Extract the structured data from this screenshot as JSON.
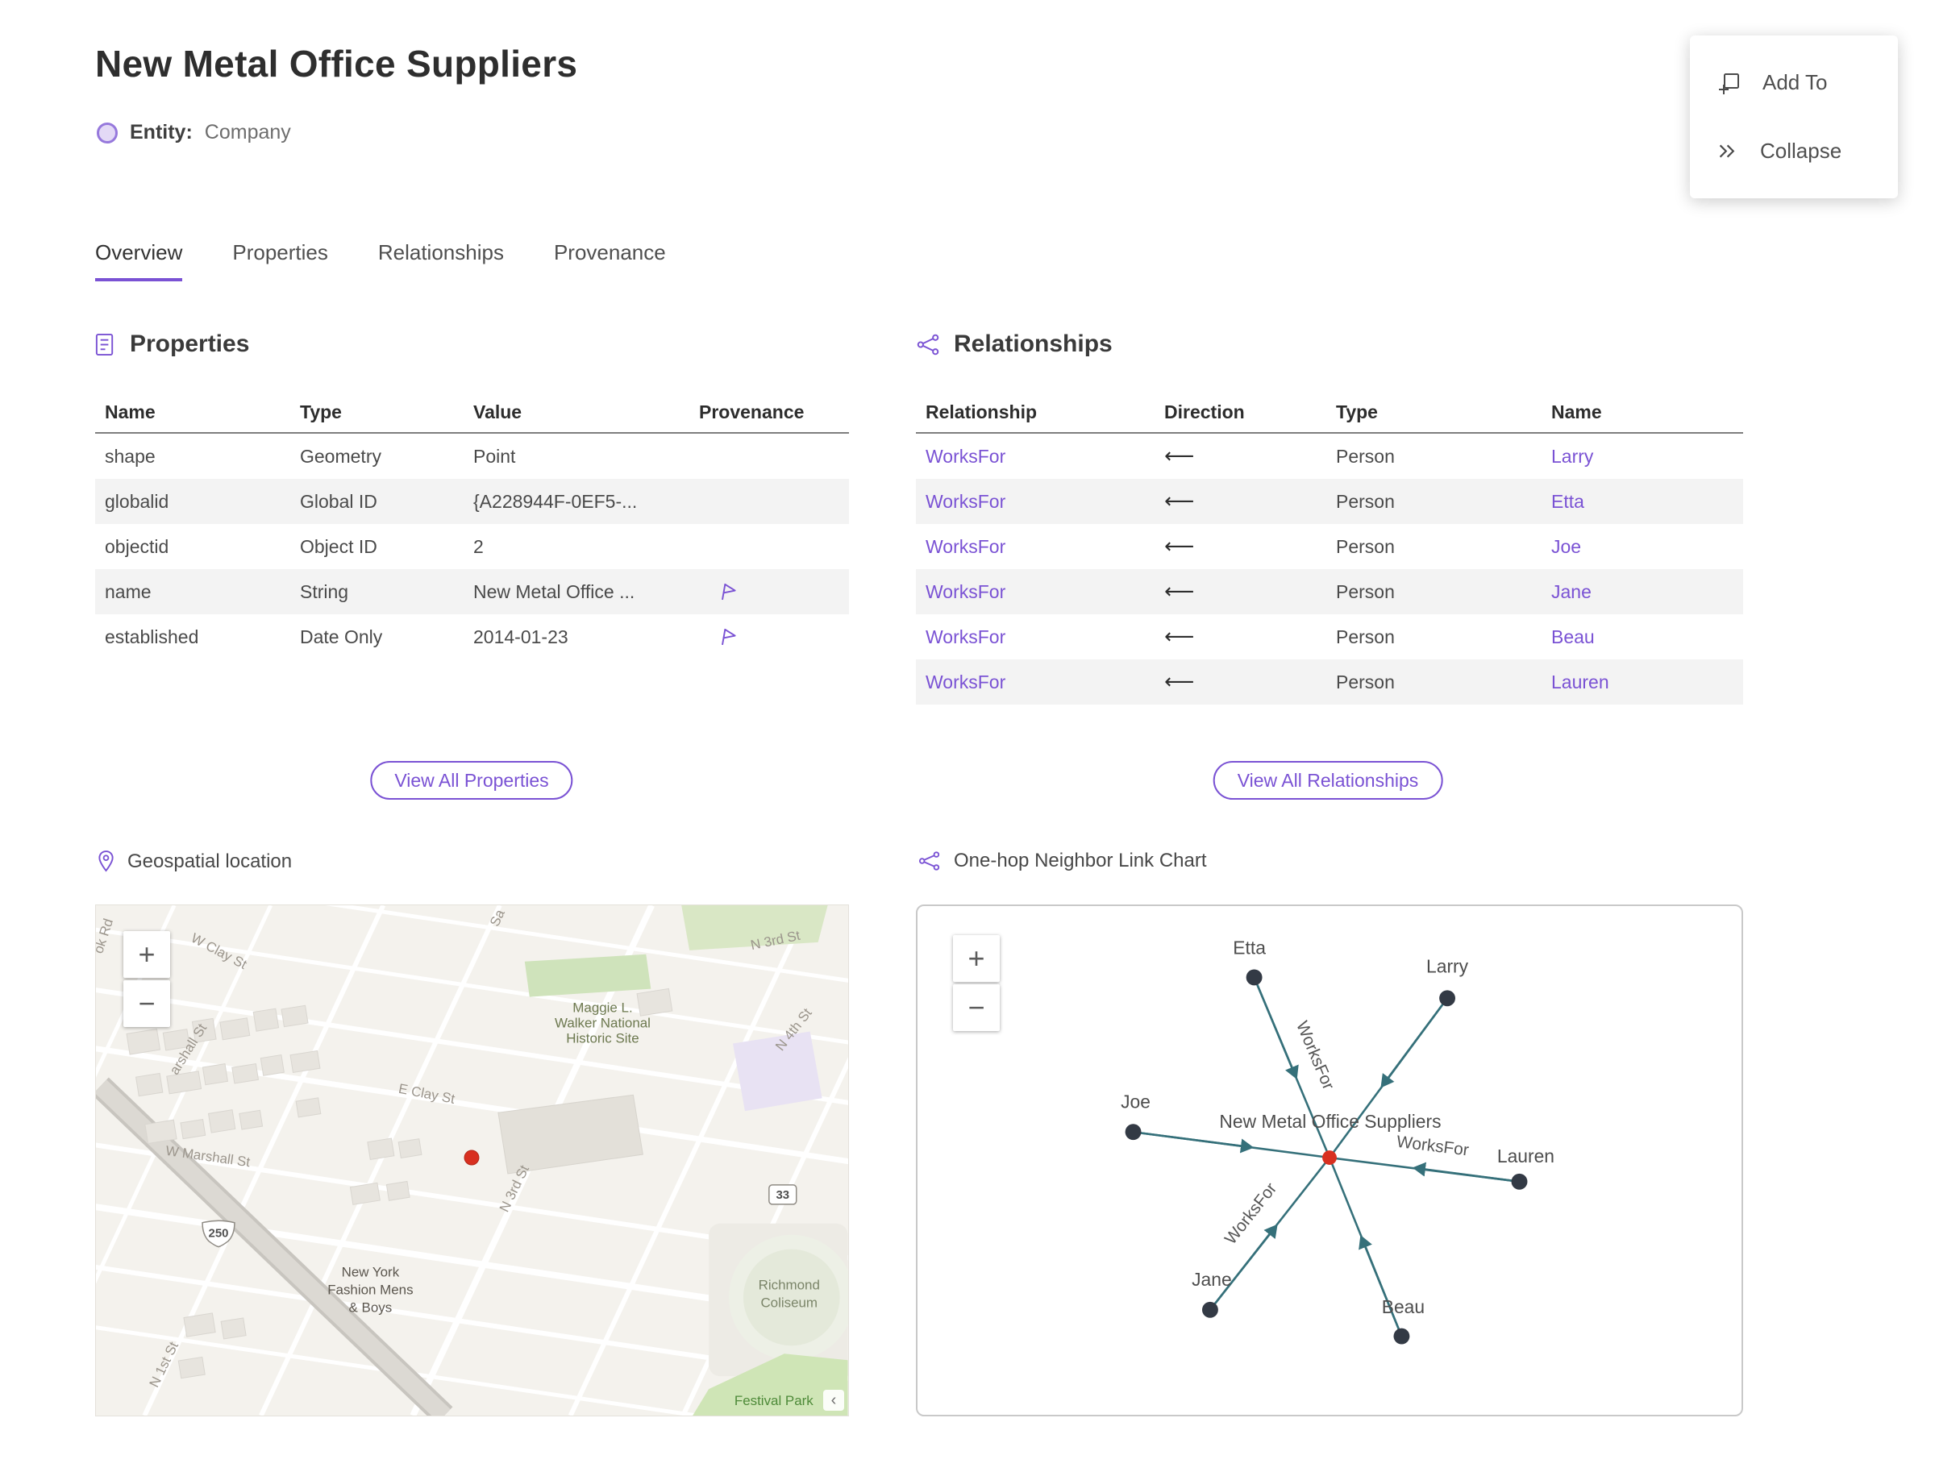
{
  "header": {
    "title": "New Metal Office Suppliers",
    "entity_label": "Entity:",
    "entity_value": "Company"
  },
  "floating_menu": {
    "add_to": "Add To",
    "collapse": "Collapse"
  },
  "tabs": [
    {
      "label": "Overview",
      "active": true
    },
    {
      "label": "Properties",
      "active": false
    },
    {
      "label": "Relationships",
      "active": false
    },
    {
      "label": "Provenance",
      "active": false
    }
  ],
  "properties": {
    "section_title": "Properties",
    "columns": [
      "Name",
      "Type",
      "Value",
      "Provenance"
    ],
    "rows": [
      {
        "name": "shape",
        "type": "Geometry",
        "value": "Point",
        "has_provenance": false
      },
      {
        "name": "globalid",
        "type": "Global ID",
        "value": "{A228944F-0EF5-...",
        "has_provenance": false
      },
      {
        "name": "objectid",
        "type": "Object ID",
        "value": "2",
        "has_provenance": false
      },
      {
        "name": "name",
        "type": "String",
        "value": "New Metal Office ...",
        "has_provenance": true
      },
      {
        "name": "established",
        "type": "Date Only",
        "value": "2014-01-23",
        "has_provenance": true
      }
    ],
    "view_all_label": "View All Properties"
  },
  "relationships": {
    "section_title": "Relationships",
    "columns": [
      "Relationship",
      "Direction",
      "Type",
      "Name"
    ],
    "rows": [
      {
        "relationship": "WorksFor",
        "direction": "⟵",
        "type": "Person",
        "name": "Larry"
      },
      {
        "relationship": "WorksFor",
        "direction": "⟵",
        "type": "Person",
        "name": "Etta"
      },
      {
        "relationship": "WorksFor",
        "direction": "⟵",
        "type": "Person",
        "name": "Joe"
      },
      {
        "relationship": "WorksFor",
        "direction": "⟵",
        "type": "Person",
        "name": "Jane"
      },
      {
        "relationship": "WorksFor",
        "direction": "⟵",
        "type": "Person",
        "name": "Beau"
      },
      {
        "relationship": "WorksFor",
        "direction": "⟵",
        "type": "Person",
        "name": "Lauren"
      }
    ],
    "view_all_label": "View All Relationships"
  },
  "map": {
    "section_title": "Geospatial location",
    "zoom_in": "+",
    "zoom_out": "−",
    "attribution_toggle": "‹",
    "streets": {
      "ok_rd": "ok Rd",
      "w_clay": "W Clay St",
      "sa": "Sa",
      "n3rd_top": "N 3rd St",
      "n4th": "N 4th St",
      "e_clay": "E Clay St",
      "marshall_partial": "arshall St",
      "w_marshall": "W Marshall St",
      "n3rd_mid": "N 3rd St",
      "n1st": "N 1st St"
    },
    "shields": {
      "us_250": "250",
      "route_33": "33"
    },
    "landmarks": {
      "maggie": [
        "Maggie L.",
        "Walker National",
        "Historic Site"
      ],
      "ny_fashion": [
        "New York",
        "Fashion Mens",
        "& Boys"
      ],
      "coliseum": [
        "Richmond",
        "Coliseum"
      ],
      "festival_park": "Festival Park"
    }
  },
  "link_chart": {
    "section_title": "One-hop Neighbor Link Chart",
    "zoom_in": "+",
    "zoom_out": "−",
    "center_label": "New Metal Office Suppliers",
    "edge_label": "WorksFor",
    "nodes": [
      "Etta",
      "Larry",
      "Joe",
      "Lauren",
      "Jane",
      "Beau"
    ]
  },
  "colors": {
    "accent_purple": "#7a52d4",
    "edge_teal": "#35707a",
    "node_dark": "#333a45",
    "center_node_red": "#d83020",
    "row_stripe": "#f3f3f3"
  }
}
